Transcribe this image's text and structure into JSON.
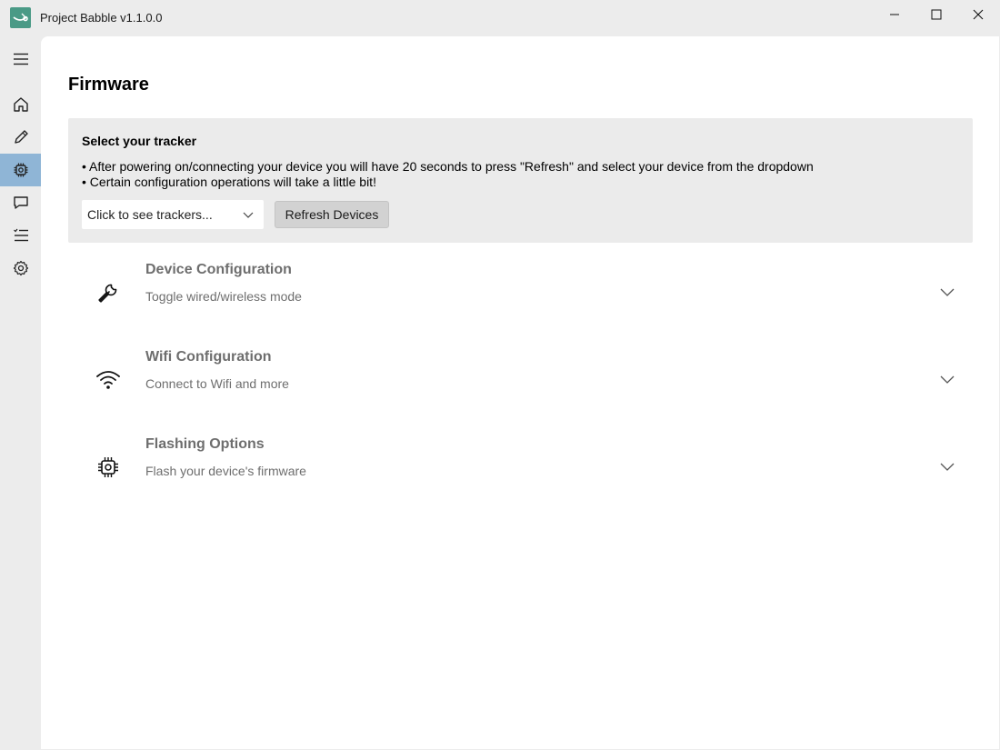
{
  "window": {
    "title": "Project Babble v1.1.0.0"
  },
  "sidebar": {
    "items": [
      {
        "id": "menu",
        "icon": "hamburger-menu-icon"
      },
      {
        "id": "home",
        "icon": "home-icon"
      },
      {
        "id": "edit",
        "icon": "pencil-icon"
      },
      {
        "id": "firmware",
        "icon": "chip-icon",
        "active": true
      },
      {
        "id": "chat",
        "icon": "chat-bubble-icon"
      },
      {
        "id": "list",
        "icon": "list-icon"
      },
      {
        "id": "settings",
        "icon": "gear-icon"
      }
    ],
    "active_color": "#8fb5d6"
  },
  "page": {
    "title": "Firmware"
  },
  "tracker_panel": {
    "title": "Select your tracker",
    "notes": [
      "After powering on/connecting your device you will have 20 seconds to press \"Refresh\" and select your device from the dropdown",
      "Certain configuration operations will take a little bit!"
    ],
    "select_value": "Click to see trackers...",
    "refresh_label": "Refresh Devices"
  },
  "sections": [
    {
      "icon": "wrench-icon",
      "title": "Device Configuration",
      "description": "Toggle wired/wireless mode"
    },
    {
      "icon": "wifi-icon",
      "title": "Wifi Configuration",
      "description": "Connect to Wifi and more"
    },
    {
      "icon": "chip-icon",
      "title": "Flashing Options",
      "description": "Flash your device's firmware"
    }
  ],
  "colors": {
    "accent": "#4a9a86",
    "section_text": "#6e6e6e"
  }
}
